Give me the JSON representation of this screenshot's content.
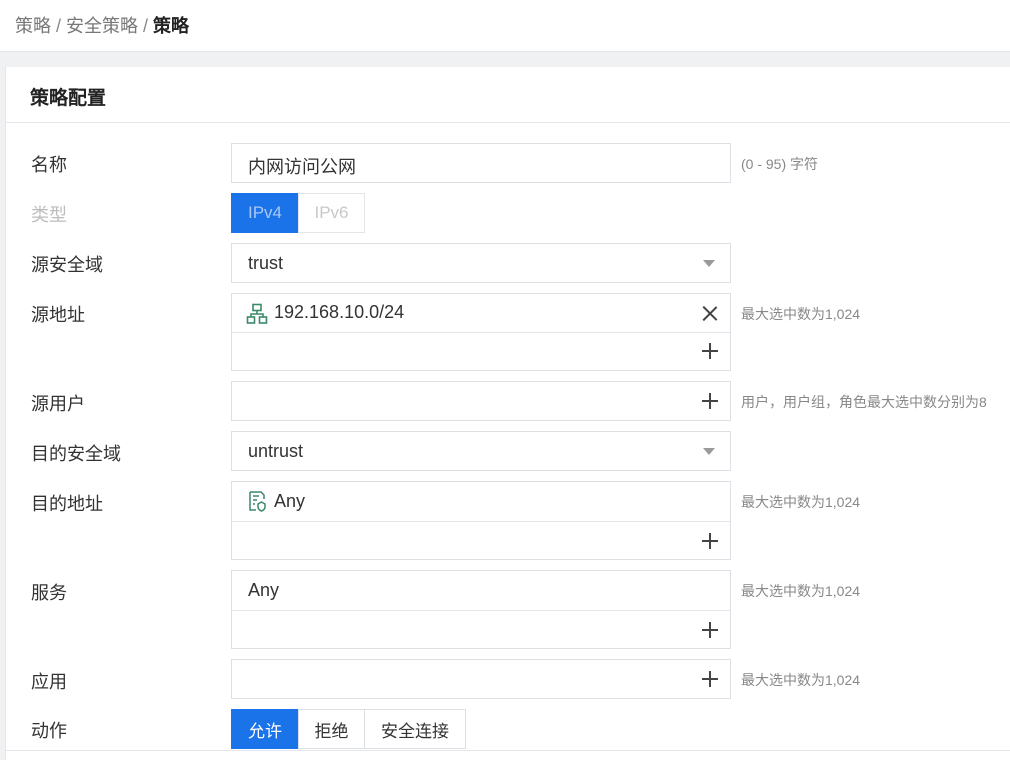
{
  "breadcrumb": {
    "items": [
      "策略",
      "安全策略"
    ],
    "current": "策略"
  },
  "card": {
    "title": "策略配置"
  },
  "form": {
    "name": {
      "label": "名称",
      "value": "内网访问公网",
      "hint": "(0 - 95) 字符"
    },
    "type": {
      "label": "类型",
      "options": [
        "IPv4",
        "IPv6"
      ],
      "selected": "IPv4"
    },
    "src_zone": {
      "label": "源安全域",
      "value": "trust"
    },
    "src_addr": {
      "label": "源地址",
      "item": "192.168.10.0/24",
      "item_icon": "network-topology-icon",
      "hint": "最大选中数为1,024"
    },
    "src_user": {
      "label": "源用户",
      "hint": "用户，用户组，角色最大选中数分别为8"
    },
    "dst_zone": {
      "label": "目的安全域",
      "value": "untrust"
    },
    "dst_addr": {
      "label": "目的地址",
      "item": "Any",
      "item_icon": "address-book-icon",
      "hint": "最大选中数为1,024"
    },
    "service": {
      "label": "服务",
      "item": "Any",
      "hint": "最大选中数为1,024"
    },
    "app": {
      "label": "应用",
      "hint": "最大选中数为1,024"
    },
    "action": {
      "label": "动作",
      "options": [
        "允许",
        "拒绝",
        "安全连接"
      ],
      "selected": "允许"
    }
  },
  "colors": {
    "accent": "#1a73e8",
    "icon_green": "#3a8a6a"
  }
}
